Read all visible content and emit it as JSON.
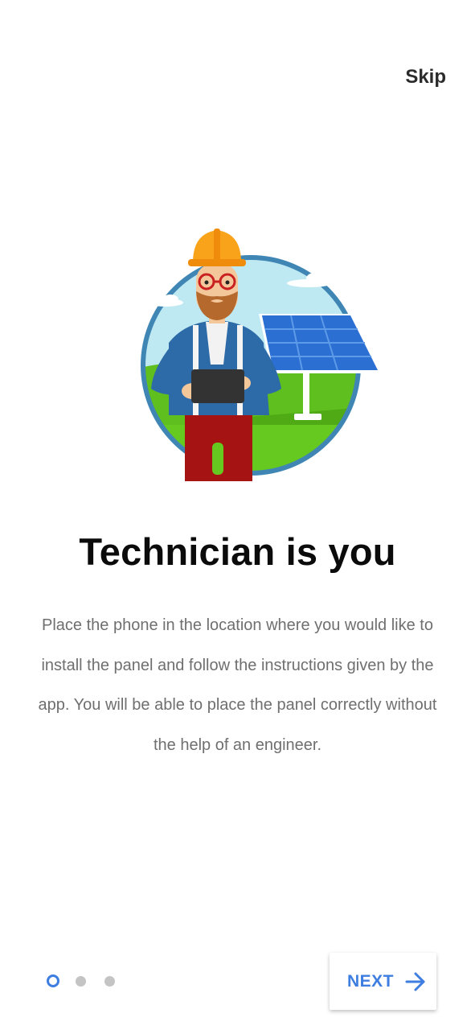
{
  "header": {
    "skip_label": "Skip"
  },
  "slide": {
    "title": "Technician is you",
    "description": "Place the phone in the location where you would like to install the panel and follow the instructions given by the app. You will be able to place the panel correctly without the help of an engineer.",
    "illustration_icon": "technician-solar-panel-illustration"
  },
  "pager": {
    "total": 3,
    "current": 1
  },
  "footer": {
    "next_label": "NEXT",
    "next_icon": "arrow-right-icon"
  },
  "colors": {
    "accent": "#3d7ee0",
    "title": "#0b0b0b",
    "body_text": "#6f6f6f",
    "dot_inactive": "#c4c4c4"
  }
}
